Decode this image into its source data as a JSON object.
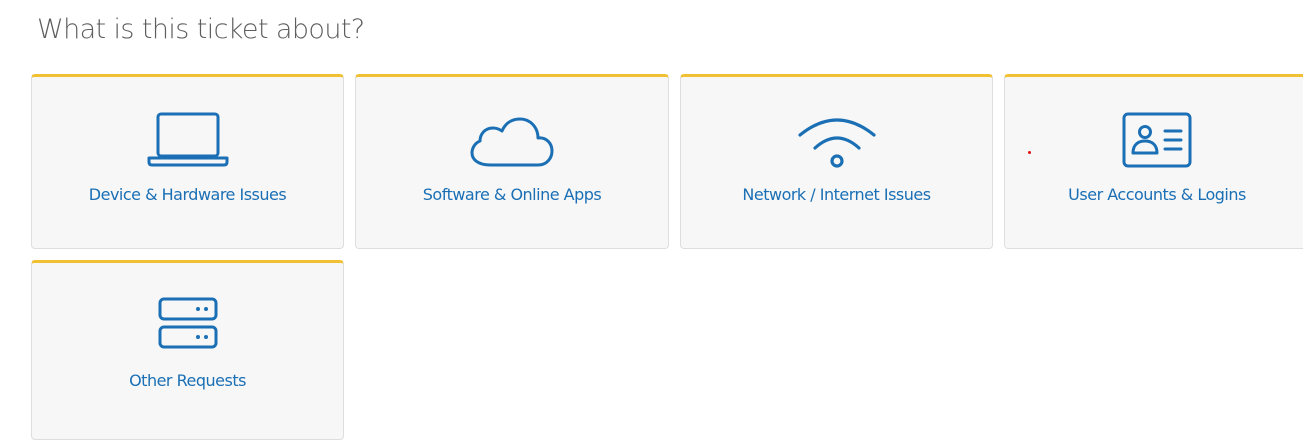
{
  "page": {
    "title": "What is this ticket about?"
  },
  "categories": [
    {
      "label": "Device & Hardware Issues",
      "icon": "laptop-icon"
    },
    {
      "label": "Software & Online Apps",
      "icon": "cloud-icon"
    },
    {
      "label": "Network / Internet Issues",
      "icon": "wifi-icon"
    },
    {
      "label": "User Accounts & Logins",
      "icon": "id-card-icon"
    },
    {
      "label": "Other Requests",
      "icon": "server-icon"
    }
  ],
  "colors": {
    "accent_border": "#f2c033",
    "icon_and_label": "#1a6fb5",
    "card_background": "#f7f7f7",
    "title_text": "#5e5e5e"
  }
}
